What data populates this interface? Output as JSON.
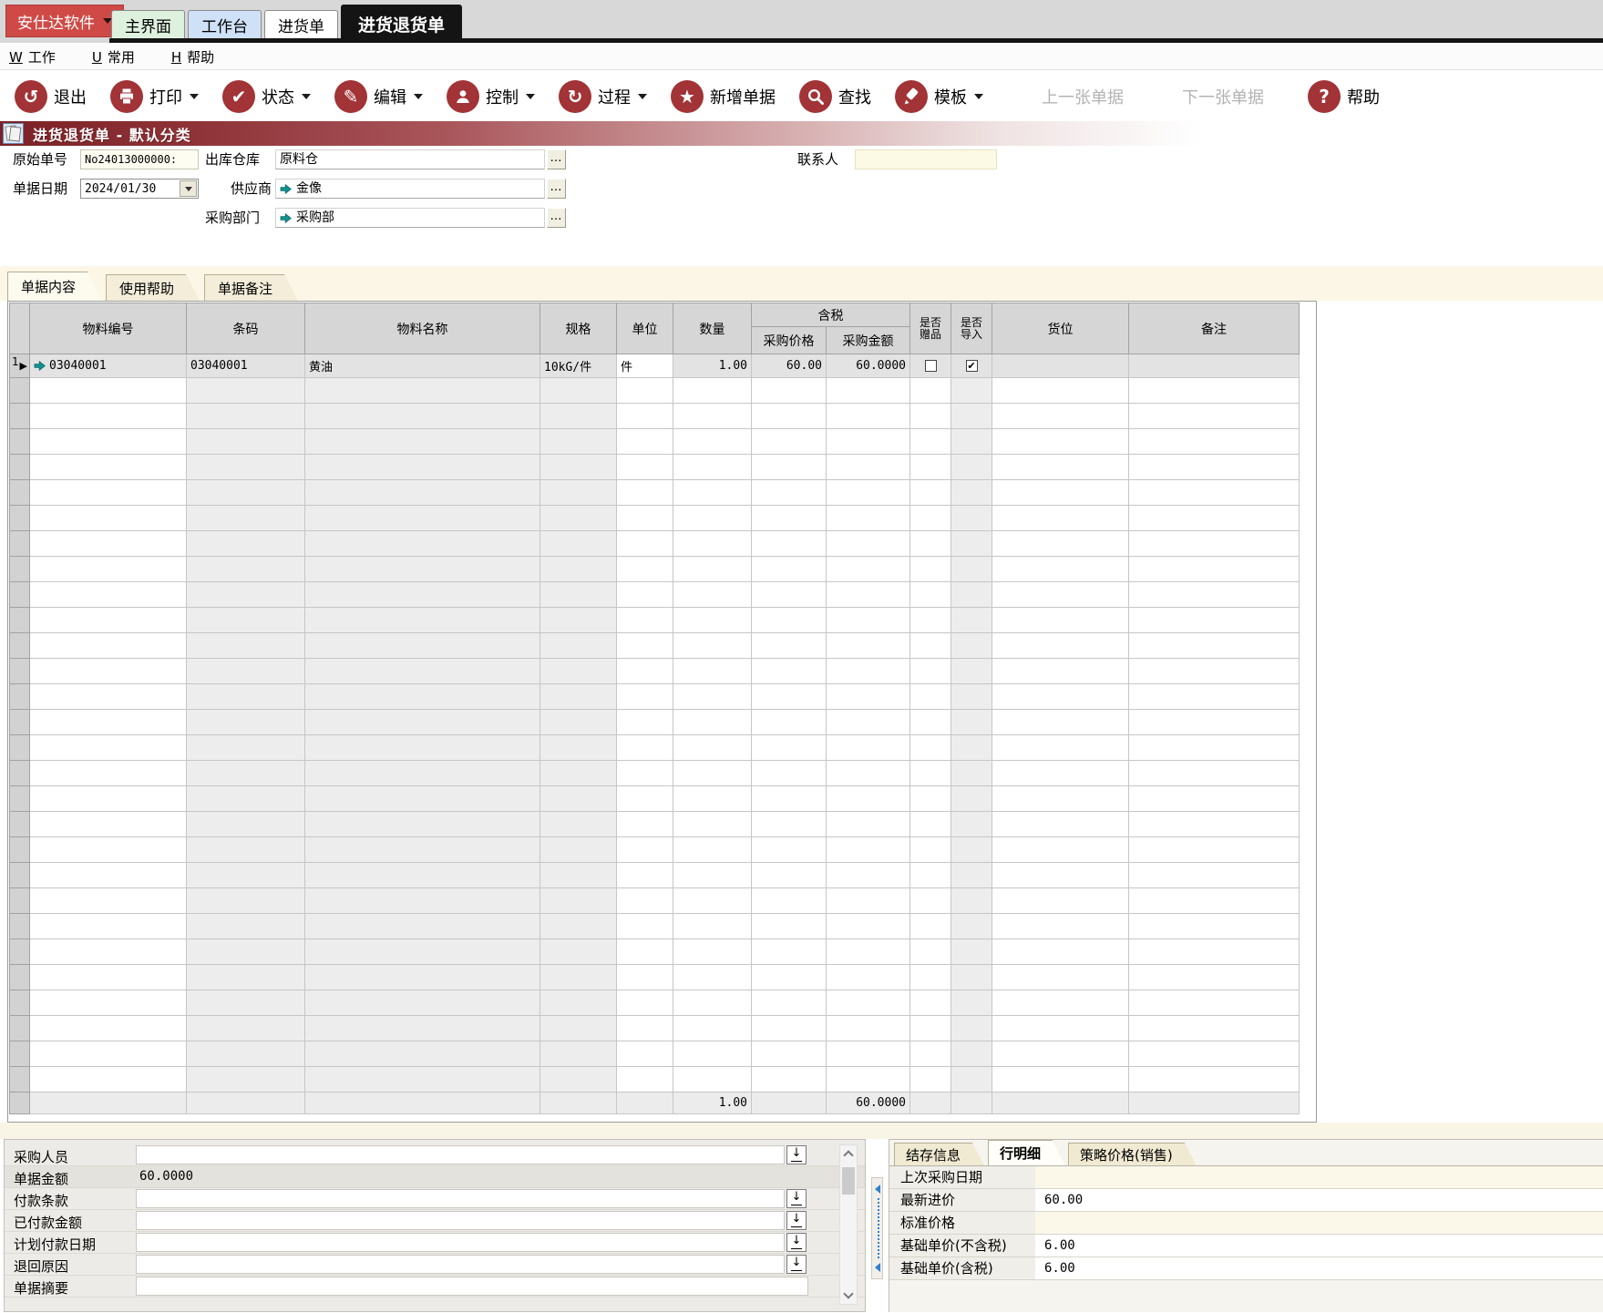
{
  "topbar": {
    "app_button": "安仕达软件",
    "tabs": [
      {
        "label": "主界面"
      },
      {
        "label": "工作台"
      },
      {
        "label": "进货单"
      },
      {
        "label": "进货退货单"
      }
    ]
  },
  "menubar": {
    "items": [
      {
        "key": "W",
        "label": "工作"
      },
      {
        "key": "U",
        "label": "常用"
      },
      {
        "key": "H",
        "label": "帮助"
      }
    ]
  },
  "toolbar": {
    "items": [
      {
        "label": "退出",
        "glyph": "↺"
      },
      {
        "label": "打印",
        "dropdown": true
      },
      {
        "label": "状态",
        "glyph": "✔",
        "dropdown": true
      },
      {
        "label": "编辑",
        "glyph": "✎",
        "dropdown": true
      },
      {
        "label": "控制",
        "dropdown": true
      },
      {
        "label": "过程",
        "glyph": "↻",
        "dropdown": true
      },
      {
        "label": "新增单据",
        "glyph": "★"
      },
      {
        "label": "查找"
      },
      {
        "label": "模板",
        "dropdown": true
      },
      {
        "label": "上一张单据",
        "disabled": true
      },
      {
        "label": "下一张单据",
        "disabled": true
      },
      {
        "label": "帮助",
        "glyph": "?"
      }
    ]
  },
  "banner": {
    "title": "进货退货单 - 默认分类"
  },
  "form": {
    "original_no_label": "原始单号",
    "original_no_value": "No24013000000:",
    "doc_date_label": "单据日期",
    "doc_date_value": "2024/01/30",
    "warehouse_label": "出库仓库",
    "warehouse_value": "原料仓",
    "supplier_label": "供应商",
    "supplier_value": "金像",
    "dept_label": "采购部门",
    "dept_value": "采购部",
    "contact_label": "联系人",
    "contact_value": "",
    "browse_label": "…"
  },
  "content_tabs": [
    {
      "label": "单据内容"
    },
    {
      "label": "使用帮助"
    },
    {
      "label": "单据备注"
    }
  ],
  "grid": {
    "headers": {
      "material_no": "物料编号",
      "barcode": "条码",
      "material_name": "物料名称",
      "spec": "规格",
      "unit": "单位",
      "qty": "数量",
      "tax_group": "含税",
      "price": "采购价格",
      "amount": "采购金额",
      "gift_line1": "是否",
      "gift_line2": "赠品",
      "import_line1": "是否",
      "import_line2": "导入",
      "location": "货位",
      "remark": "备注"
    },
    "row1": {
      "num": "1",
      "marker": "▶",
      "material_no": "03040001",
      "barcode": "03040001",
      "material_name": "黄油",
      "spec": "10kG/件",
      "unit": "件",
      "qty": "1.00",
      "price": "60.00",
      "amount": "60.0000",
      "gift_mark": "",
      "import_mark": "✔"
    },
    "empty_row_count": 28,
    "totals": {
      "qty": "1.00",
      "amount": "60.0000"
    }
  },
  "bottom_left": {
    "drop_glyph": "↓",
    "rows": [
      {
        "label": "采购人员",
        "value": ""
      },
      {
        "label": "单据金额",
        "value": "60.0000"
      },
      {
        "label": "付款条款",
        "value": ""
      },
      {
        "label": "已付款金额",
        "value": ""
      },
      {
        "label": "计划付款日期",
        "value": ""
      },
      {
        "label": "退回原因",
        "value": ""
      },
      {
        "label": "单据摘要",
        "value": ""
      }
    ]
  },
  "bottom_right": {
    "tabs": [
      {
        "label": "结存信息"
      },
      {
        "label": "行明细"
      },
      {
        "label": "策略价格(销售)"
      }
    ],
    "rows": [
      {
        "label": "上次采购日期",
        "value": ""
      },
      {
        "label": "最新进价",
        "value": "60.00"
      },
      {
        "label": "标准价格",
        "value": ""
      },
      {
        "label": "基础单价(不含税)",
        "value": "6.00"
      },
      {
        "label": "基础单价(含税)",
        "value": "6.00"
      }
    ]
  },
  "colors": {
    "brand_red": "#cf4a46",
    "toolbar_icon_red": "#a23336",
    "teal_arrow": "#13918f",
    "banner_dark": "#7c2126"
  }
}
